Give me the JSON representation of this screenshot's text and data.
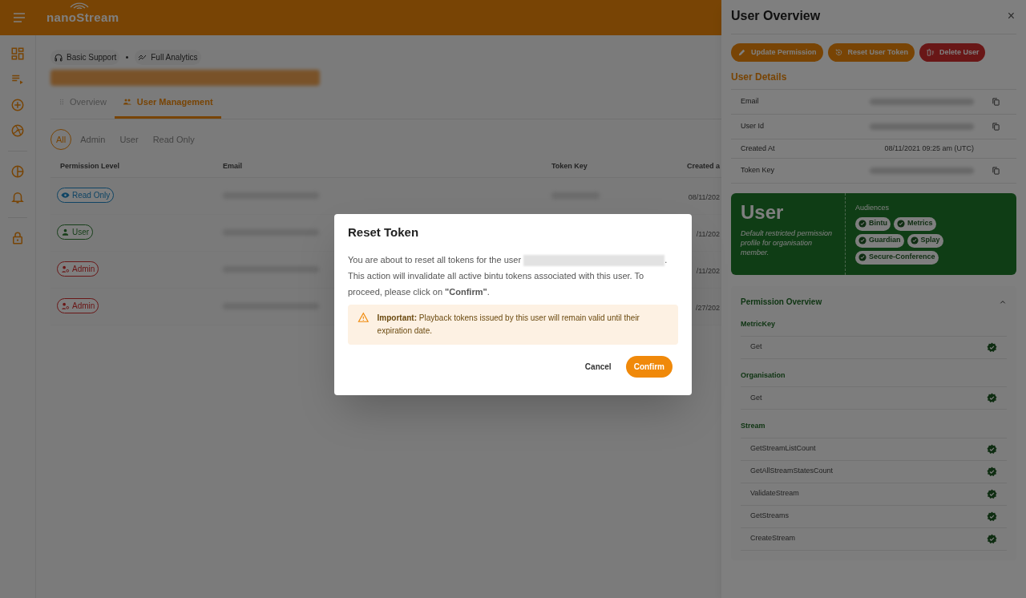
{
  "header": {
    "logo": "nanoStream"
  },
  "sidebar": {
    "items": [
      {
        "kind": "dashboard"
      },
      {
        "kind": "playlist"
      },
      {
        "kind": "add"
      },
      {
        "kind": "aperture"
      },
      {
        "kind": "divider"
      },
      {
        "kind": "chart"
      },
      {
        "kind": "bell"
      },
      {
        "kind": "divider"
      },
      {
        "kind": "lock"
      }
    ]
  },
  "chips": [
    {
      "label": "Basic Support",
      "kind": "support"
    },
    {
      "label": "Full Analytics",
      "kind": "analytics"
    }
  ],
  "tabs": [
    {
      "label": "Overview",
      "selected": false,
      "kind": "grid"
    },
    {
      "label": "User Management",
      "selected": true,
      "kind": "users"
    }
  ],
  "filters": [
    {
      "label": "All",
      "selected": true
    },
    {
      "label": "Admin",
      "selected": false
    },
    {
      "label": "User",
      "selected": false
    },
    {
      "label": "Read Only",
      "selected": false
    }
  ],
  "table": {
    "columns": [
      "Permission Level",
      "Email",
      "Token Key",
      "Created a"
    ],
    "rows": [
      {
        "permission": "Read Only",
        "kind": "readonly",
        "created": "08/11/202"
      },
      {
        "permission": "User",
        "kind": "user",
        "created": "/11/202"
      },
      {
        "permission": "Admin",
        "kind": "admin",
        "created": "/11/202"
      },
      {
        "permission": "Admin",
        "kind": "admin",
        "created": "/27/202"
      }
    ]
  },
  "dialog": {
    "title": "Reset Token",
    "body_start": "You are about to reset all tokens for the user",
    "body_end": ". This action will invalidate all active bintu tokens associated with this user. To proceed, please click on **\"Confirm\"**.",
    "note": "**Important:** Playback tokens issued by this user will remain valid until their expiration date.",
    "cancel": "Cancel",
    "confirm": "Confirm"
  },
  "drawer": {
    "title": "User Overview",
    "close": "×",
    "actions": [
      {
        "label": "Update Permission",
        "kind": "edit"
      },
      {
        "label": "Reset User Token",
        "kind": "reset"
      },
      {
        "label": "Delete User",
        "kind": "delete"
      }
    ],
    "details_title": "User Details",
    "details": [
      {
        "label": "Email",
        "copyable": true
      },
      {
        "label": "User Id",
        "copyable": true
      },
      {
        "label": "Created At",
        "value": "08/11/2021 09:25 am (UTC)",
        "copyable": false
      },
      {
        "label": "Token Key",
        "copyable": true
      }
    ],
    "profile": {
      "name": "User",
      "description": "Default restricted permission profile for organisation member.",
      "audiences_label": "Audiences",
      "audiences": [
        "Bintu",
        "Metrics",
        "Guardian",
        "Splay",
        "Secure-Conference"
      ]
    },
    "permissions": {
      "title": "Permission Overview",
      "expanded": true,
      "groups": [
        {
          "name": "MetricKey",
          "items": [
            {
              "label": "Get",
              "granted": true
            }
          ]
        },
        {
          "name": "Organisation",
          "items": [
            {
              "label": "Get",
              "granted": true
            }
          ]
        },
        {
          "name": "Stream",
          "items": [
            {
              "label": "GetStreamListCount",
              "granted": true
            },
            {
              "label": "GetAllStreamStatesCount",
              "granted": true
            },
            {
              "label": "ValidateStream",
              "granted": true
            },
            {
              "label": "GetStreams",
              "granted": true
            },
            {
              "label": "CreateStream",
              "granted": true
            }
          ]
        }
      ]
    }
  }
}
